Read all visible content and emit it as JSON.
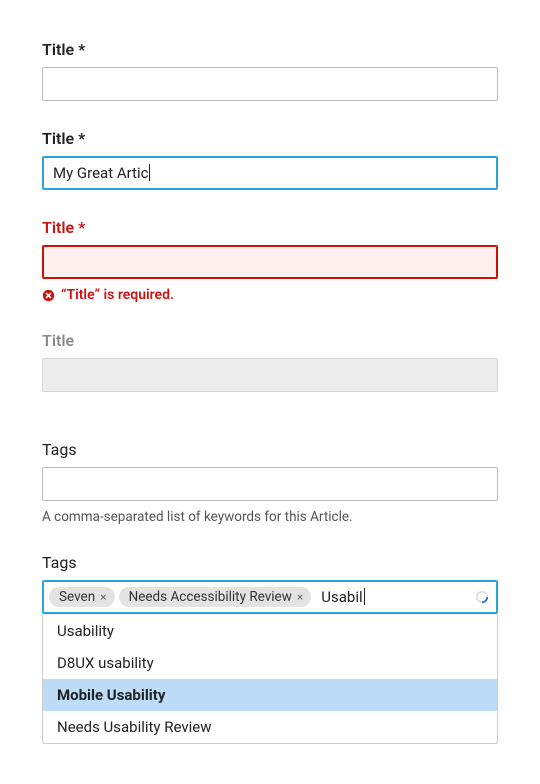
{
  "field1": {
    "label": "Title",
    "required_marker": "*",
    "value": ""
  },
  "field2": {
    "label": "Title",
    "required_marker": "*",
    "value": "My Great Artic"
  },
  "field3": {
    "label": "Title",
    "required_marker": "*",
    "value": "",
    "error_message": "“Title” is required."
  },
  "field4": {
    "label": "Title",
    "value": ""
  },
  "tags1": {
    "label": "Tags",
    "value": "",
    "helper": "A comma-separated list of keywords for this Article."
  },
  "tags2": {
    "label": "Tags",
    "chips": [
      {
        "label": "Seven"
      },
      {
        "label": "Needs Accessibility Review"
      }
    ],
    "typing": "Usabil",
    "options": [
      {
        "label": "Usability",
        "selected": false
      },
      {
        "label": "D8UX usability",
        "selected": false
      },
      {
        "label": "Mobile Usability",
        "selected": true
      },
      {
        "label": "Needs Usability Review",
        "selected": false
      }
    ]
  },
  "icons": {
    "remove": "×"
  }
}
